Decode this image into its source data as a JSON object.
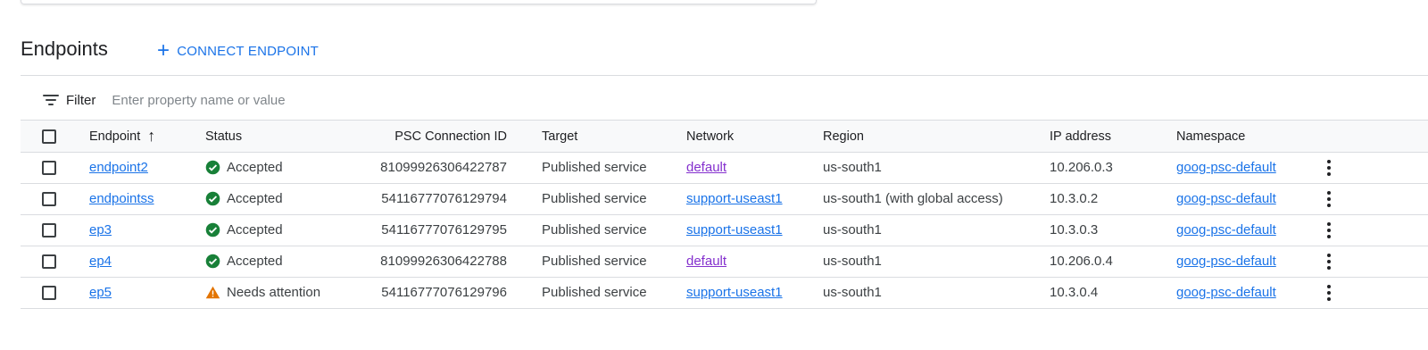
{
  "section": {
    "title": "Endpoints",
    "connect_label": "CONNECT ENDPOINT"
  },
  "filter": {
    "label": "Filter",
    "placeholder": "Enter property name or value"
  },
  "columns": {
    "endpoint": "Endpoint",
    "status": "Status",
    "psc": "PSC Connection ID",
    "target": "Target",
    "network": "Network",
    "region": "Region",
    "ip": "IP address",
    "namespace": "Namespace"
  },
  "rows": [
    {
      "endpoint": "endpoint2",
      "status": "Accepted",
      "status_type": "ok",
      "psc": "81099926306422787",
      "target": "Published service",
      "network": "default",
      "region": "us-south1",
      "ip": "10.206.0.3",
      "namespace": "goog-psc-default"
    },
    {
      "endpoint": "endpointss",
      "status": "Accepted",
      "status_type": "ok",
      "psc": "54116777076129794",
      "target": "Published service",
      "network": "support-useast1",
      "region": "us-south1 (with global access)",
      "ip": "10.3.0.2",
      "namespace": "goog-psc-default"
    },
    {
      "endpoint": "ep3",
      "status": "Accepted",
      "status_type": "ok",
      "psc": "54116777076129795",
      "target": "Published service",
      "network": "support-useast1",
      "region": "us-south1",
      "ip": "10.3.0.3",
      "namespace": "goog-psc-default"
    },
    {
      "endpoint": "ep4",
      "status": "Accepted",
      "status_type": "ok",
      "psc": "81099926306422788",
      "target": "Published service",
      "network": "default",
      "region": "us-south1",
      "ip": "10.206.0.4",
      "namespace": "goog-psc-default"
    },
    {
      "endpoint": "ep5",
      "status": "Needs attention",
      "status_type": "warning",
      "psc": "54116777076129796",
      "target": "Published service",
      "network": "support-useast1",
      "region": "us-south1",
      "ip": "10.3.0.4",
      "namespace": "goog-psc-default"
    }
  ],
  "icons": {
    "add": "plus-icon",
    "filter": "filter-lines-icon",
    "sort": "arrow-up-icon",
    "ok": "check-circle-icon",
    "warning": "warning-triangle-icon",
    "menu": "more-vert-icon"
  },
  "colors": {
    "accent": "#1a73e8",
    "visited": "#8430ce",
    "ok": "#188038",
    "warning": "#e37400"
  }
}
